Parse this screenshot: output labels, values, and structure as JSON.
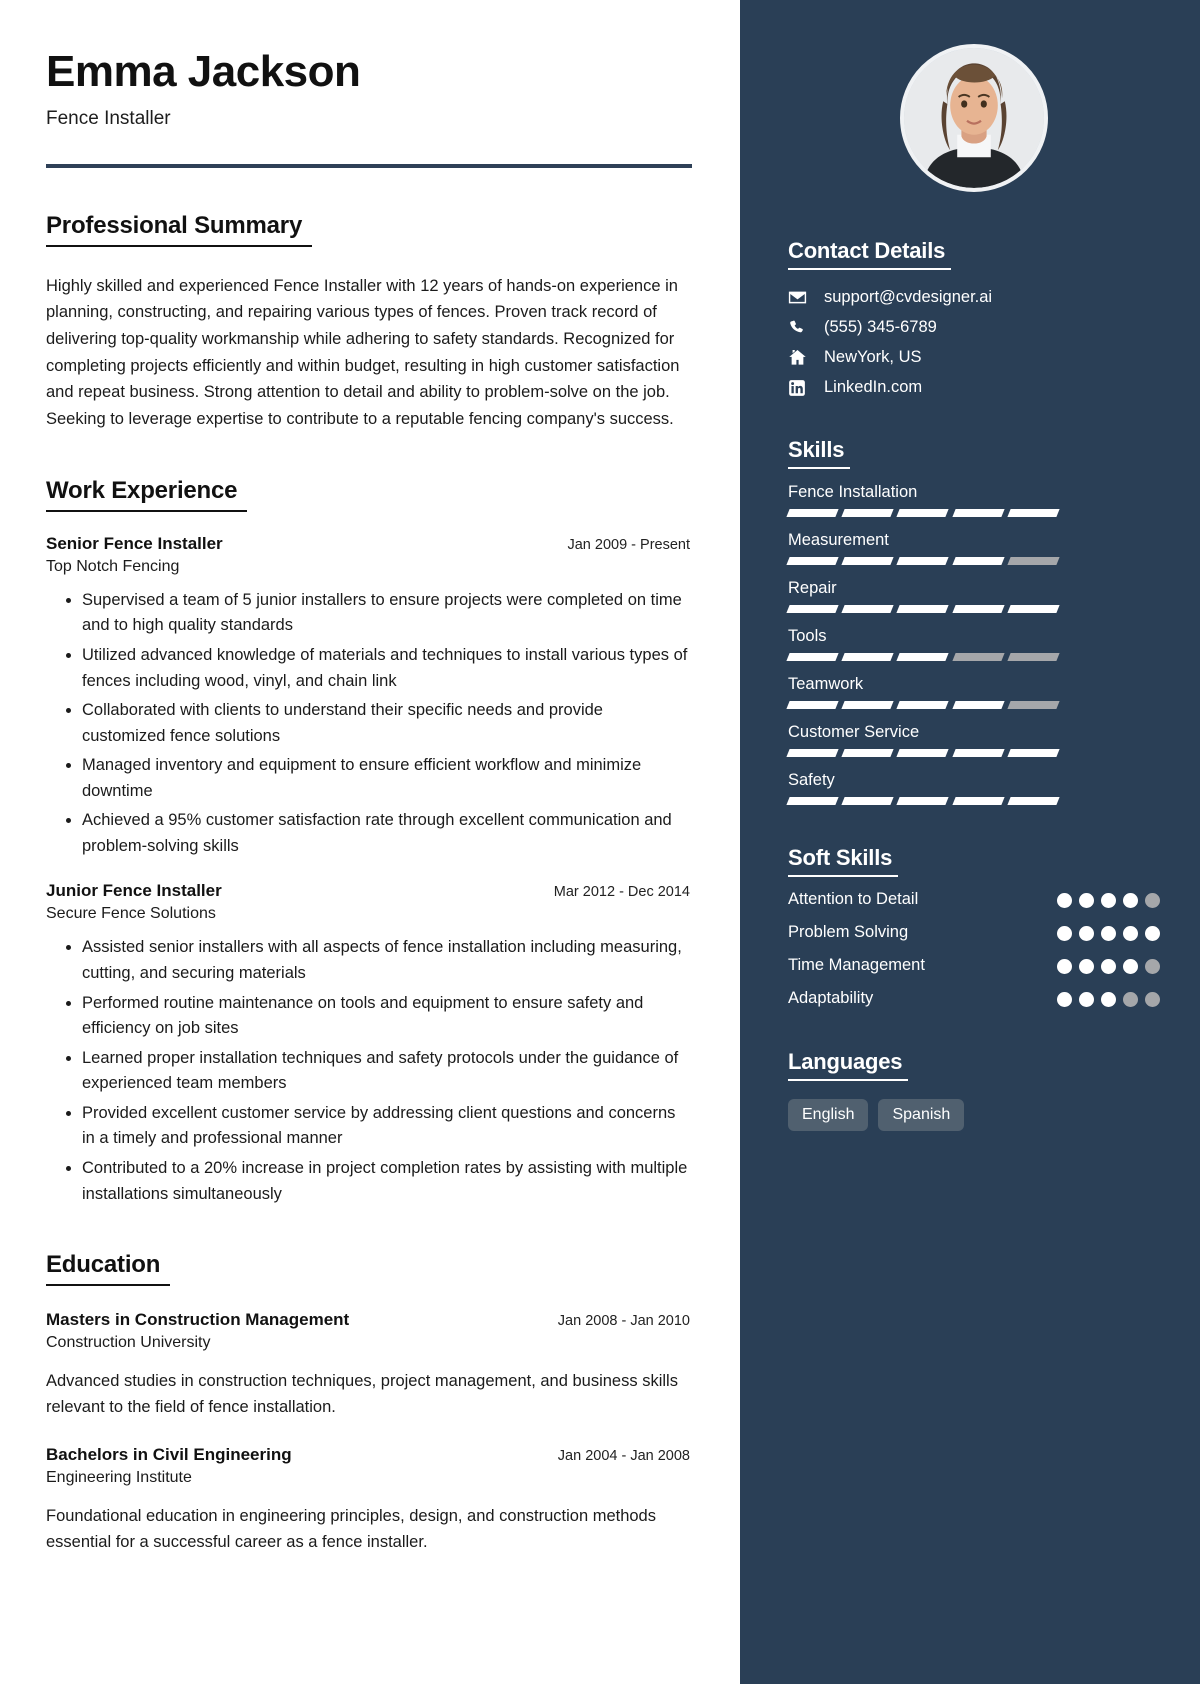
{
  "header": {
    "name": "Emma Jackson",
    "job_title": "Fence Installer"
  },
  "summary": {
    "title": "Professional Summary",
    "text": "Highly skilled and experienced Fence Installer with 12 years of hands-on experience in planning, constructing, and repairing various types of fences. Proven track record of delivering top-quality workmanship while adhering to safety standards. Recognized for completing projects efficiently and within budget, resulting in high customer satisfaction and repeat business. Strong attention to detail and ability to problem-solve on the job. Seeking to leverage expertise to contribute to a reputable fencing company's success."
  },
  "work_experience": {
    "title": "Work Experience",
    "entries": [
      {
        "role": "Senior Fence Installer",
        "date": "Jan 2009 - Present",
        "org": "Top Notch Fencing",
        "bullets": [
          "Supervised a team of 5 junior installers to ensure projects were completed on time and to high quality standards",
          "Utilized advanced knowledge of materials and techniques to install various types of fences including wood, vinyl, and chain link",
          "Collaborated with clients to understand their specific needs and provide customized fence solutions",
          "Managed inventory and equipment to ensure efficient workflow and minimize downtime",
          "Achieved a 95% customer satisfaction rate through excellent communication and problem-solving skills"
        ]
      },
      {
        "role": "Junior Fence Installer",
        "date": "Mar 2012 - Dec 2014",
        "org": "Secure Fence Solutions",
        "bullets": [
          "Assisted senior installers with all aspects of fence installation including measuring, cutting, and securing materials",
          "Performed routine maintenance on tools and equipment to ensure safety and efficiency on job sites",
          "Learned proper installation techniques and safety protocols under the guidance of experienced team members",
          "Provided excellent customer service by addressing client questions and concerns in a timely and professional manner",
          "Contributed to a 20% increase in project completion rates by assisting with multiple installations simultaneously"
        ]
      }
    ]
  },
  "education": {
    "title": "Education",
    "entries": [
      {
        "degree": "Masters in Construction Management",
        "date": "Jan 2008 - Jan 2010",
        "school": "Construction University",
        "description": "Advanced studies in construction techniques, project management, and business skills relevant to the field of fence installation."
      },
      {
        "degree": "Bachelors in Civil Engineering",
        "date": "Jan 2004 - Jan 2008",
        "school": "Engineering Institute",
        "description": "Foundational education in engineering principles, design, and construction methods essential for a successful career as a fence installer."
      }
    ]
  },
  "contact": {
    "title": "Contact Details",
    "items": [
      {
        "icon": "envelope-icon",
        "value": "support@cvdesigner.ai"
      },
      {
        "icon": "phone-icon",
        "value": "(555) 345-6789"
      },
      {
        "icon": "home-icon",
        "value": "NewYork, US"
      },
      {
        "icon": "linkedin-icon",
        "value": "LinkedIn.com"
      }
    ]
  },
  "skills": {
    "title": "Skills",
    "max": 5,
    "items": [
      {
        "name": "Fence Installation",
        "level": 5
      },
      {
        "name": "Measurement",
        "level": 4
      },
      {
        "name": "Repair",
        "level": 5
      },
      {
        "name": "Tools",
        "level": 3
      },
      {
        "name": "Teamwork",
        "level": 4
      },
      {
        "name": "Customer Service",
        "level": 5
      },
      {
        "name": "Safety",
        "level": 5
      }
    ]
  },
  "soft_skills": {
    "title": "Soft Skills",
    "max": 5,
    "items": [
      {
        "name": "Attention to Detail",
        "level": 4
      },
      {
        "name": "Problem Solving",
        "level": 5
      },
      {
        "name": "Time Management",
        "level": 4
      },
      {
        "name": "Adaptability",
        "level": 3
      }
    ]
  },
  "languages": {
    "title": "Languages",
    "items": [
      "English",
      "Spanish"
    ]
  },
  "colors": {
    "sidebar_bg": "#2a3f56",
    "rule": "#2e4057",
    "chip_bg": "#50606f",
    "filled": "#ffffff",
    "empty": "#a5a7aa"
  }
}
